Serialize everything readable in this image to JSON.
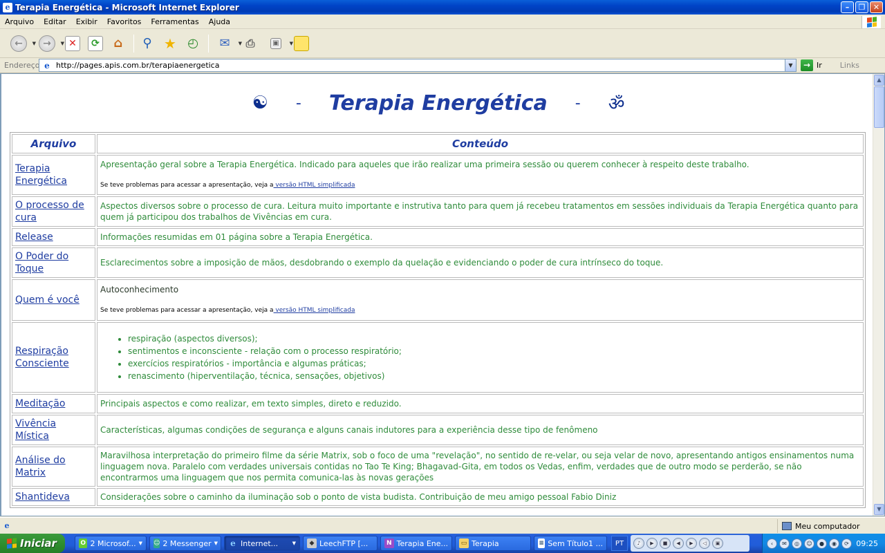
{
  "window": {
    "title": "Terapia Energética - Microsoft Internet Explorer"
  },
  "menu": [
    "Arquivo",
    "Editar",
    "Exibir",
    "Favoritos",
    "Ferramentas",
    "Ajuda"
  ],
  "address": {
    "label": "Endereço",
    "url": "http://pages.apis.com.br/terapiaenergetica",
    "go": "Ir",
    "links": "Links"
  },
  "page": {
    "heading": "Terapia Energética",
    "yin_yang": "☯",
    "om": "ॐ",
    "dash": "-",
    "col_file": "Arquivo",
    "col_content": "Conteúdo",
    "note_prefix": "Se teve problemas para acessar a apresentação, veja a",
    "note_link": " versão HTML simplificada",
    "rows": [
      {
        "file": "Terapia Energética",
        "desc": "Apresentação geral sobre a Terapia Energética. Indicado para aqueles que irão realizar uma primeira sessão ou querem conhecer à respeito deste trabalho."
      },
      {
        "file": "O processo de cura",
        "desc": "Aspectos diversos sobre o processo de cura. Leitura muito importante e instrutiva tanto para quem já recebeu tratamentos em sessões individuais da Terapia Energética quanto para quem já participou dos trabalhos de Vivências em cura."
      },
      {
        "file": "Release",
        "desc": "Informações resumidas em 01 página sobre a Terapia Energética."
      },
      {
        "file": "O Poder do Toque",
        "desc": "Esclarecimentos sobre a imposição de mãos, desdobrando o exemplo da quelação e evidenciando o poder de cura intrínseco do toque."
      },
      {
        "file": "Quem é você",
        "desc": "Autoconhecimento"
      },
      {
        "file": "Respiração Consciente",
        "bullets": [
          "respiração (aspectos diversos);",
          "sentimentos e inconsciente - relação com o processo respiratório;",
          "exercícios respiratórios - importância e algumas práticas;",
          "renascimento (hiperventilação, técnica, sensações, objetivos)"
        ]
      },
      {
        "file": "Meditação",
        "desc": "Principais aspectos e como realizar, em texto simples, direto e reduzido."
      },
      {
        "file": "Vivência Mística",
        "desc": "Características, algumas condições de segurança e alguns canais indutores para a experiência desse tipo de fenômeno"
      },
      {
        "file": "Análise do Matrix",
        "desc": "Maravilhosa interpretação do primeiro filme da série Matrix, sob o foco de uma \"revelação\", no sentido de re-velar, ou seja velar de novo, apresentando antigos ensinamentos numa linguagem nova. Paralelo com verdades universais contidas no Tao Te King; Bhagavad-Gita, em todos os Vedas, enfim, verdades que de outro modo se perderão, se não encontrarmos uma linguagem que nos permita comunica-las às novas gerações"
      },
      {
        "file": "Shantideva",
        "desc": "Considerações sobre o caminho da iluminação sob o ponto de vista budista. Contribuição de meu amigo pessoal Fabio Diniz"
      }
    ]
  },
  "status": {
    "zone": "Meu computador"
  },
  "taskbar": {
    "start": "Iniciar",
    "tasks": [
      "2 Microsof...",
      "2 Messenger",
      "Internet...",
      "LeechFTP [...",
      "Terapia Ene...",
      "Terapia",
      "Sem Título1 ..."
    ],
    "lang": "PT",
    "clock": "09:25"
  },
  "colors": {
    "link": "#1f3da1",
    "desc_text": "#2e8b3a",
    "title_bar": "#0043c6"
  }
}
